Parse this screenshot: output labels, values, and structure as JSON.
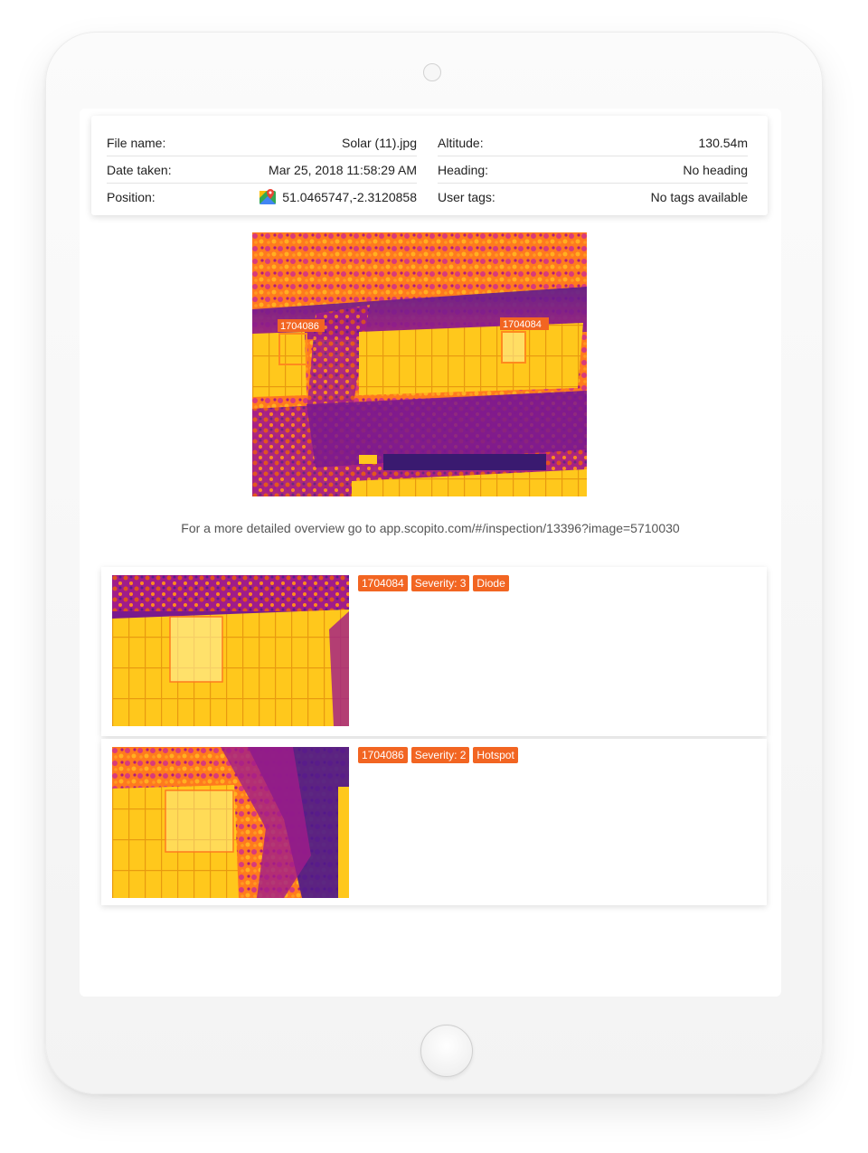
{
  "metadata": {
    "left": [
      {
        "label": "File name:",
        "value": "Solar (11).jpg"
      },
      {
        "label": "Date taken:",
        "value": "Mar 25, 2018 11:58:29 AM"
      },
      {
        "label": "Position:",
        "value": "51.0465747,-2.3120858",
        "icon": "google-maps-icon"
      }
    ],
    "right": [
      {
        "label": "Altitude:",
        "value": "130.54m"
      },
      {
        "label": "Heading:",
        "value": "No heading"
      },
      {
        "label": "User tags:",
        "value": "No tags available"
      }
    ]
  },
  "image": {
    "markers": [
      "1704086",
      "1704084"
    ]
  },
  "overview_link": "For a more detailed overview go to app.scopito.com/#/inspection/13396?image=5710030",
  "findings": [
    {
      "id": "1704084",
      "severity": "Severity: 3",
      "type": "Diode"
    },
    {
      "id": "1704086",
      "severity": "Severity: 2",
      "type": "Hotspot"
    }
  ],
  "colors": {
    "accent": "#f26522",
    "thermal_hot": "#ffd21a",
    "thermal_warm": "#ff7a1e",
    "thermal_cool": "#c2188f",
    "thermal_cold": "#4a1a8c"
  }
}
